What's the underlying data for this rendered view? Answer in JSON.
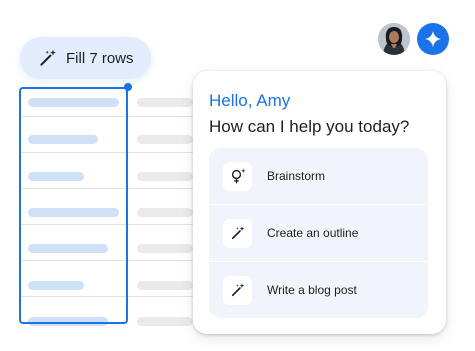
{
  "toolbar": {
    "fill_label": "Fill 7 rows",
    "fill_icon": "magic-wand-icon"
  },
  "header": {
    "avatar_icon": "user-avatar",
    "gemini_icon": "gemini-sparkle-icon"
  },
  "panel": {
    "greeting": "Hello, Amy",
    "prompt": "How can I help you today?",
    "suggestions": [
      {
        "label": "Brainstorm",
        "icon": "lightbulb-sparkle-icon"
      },
      {
        "label": "Create an outline",
        "icon": "magic-wand-icon"
      },
      {
        "label": "Write a blog post",
        "icon": "magic-wand-icon"
      }
    ]
  },
  "colors": {
    "accent": "#1a73e8",
    "chip_bg": "#e3ecfc",
    "suggestion_bg": "#f1f4fa",
    "placeholder_blue": "#cfe0f9",
    "placeholder_grey": "#eaeaea"
  }
}
